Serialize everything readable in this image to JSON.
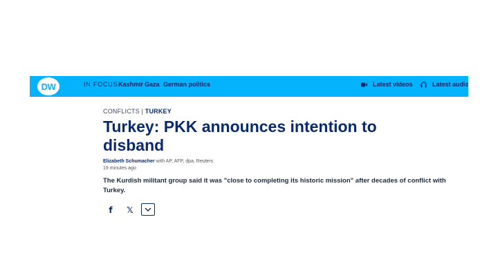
{
  "header": {
    "logo_text": "DW",
    "focus_label": "IN FOCUS",
    "topics": [
      "Kashmir",
      "Gaza",
      "German politics"
    ],
    "latest_videos_label": "Latest videos",
    "latest_audio_label": "Latest audio",
    "brand_color": "#05b2fc"
  },
  "article": {
    "category": "CONFLICTS",
    "separator": "|",
    "subcategory": "TURKEY",
    "headline": "Turkey: PKK announces intention to disband",
    "author": "Elizabeth Schumacher",
    "sources": "with AP, AFP, dpa, Reuters",
    "time_ago": "19 minutes ago",
    "teaser": "The Kurdish militant group said it was \"close to completing its historic mission\" after decades of conflict with Turkey.",
    "headline_color": "#0a2a6c"
  },
  "share": {
    "facebook_glyph": "f",
    "x_glyph": "𝕏"
  },
  "icons": {
    "video": "video-camera-icon",
    "audio": "headphones-icon",
    "more": "chevron-down-icon"
  }
}
